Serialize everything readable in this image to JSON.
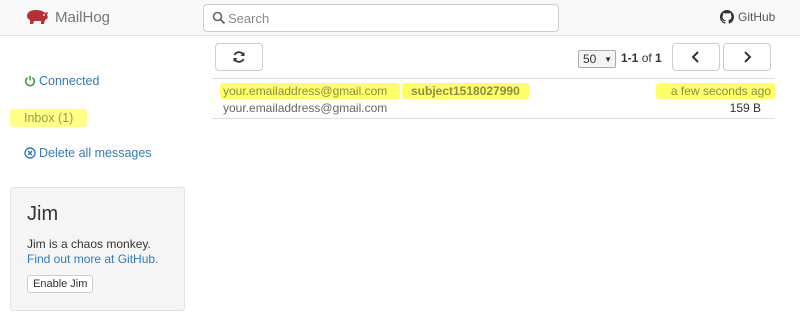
{
  "navbar": {
    "brand": "MailHog",
    "search_placeholder": "Search",
    "github_label": "GitHub"
  },
  "sidebar": {
    "connected_label": "Connected",
    "inbox_label": "Inbox (1)",
    "delete_label": "Delete all messages",
    "jim": {
      "title": "Jim",
      "description": "Jim is a chaos monkey.",
      "link_label": "Find out more at GitHub.",
      "button_label": "Enable Jim"
    }
  },
  "toolbar": {
    "per_page": "50",
    "range": "1-1",
    "of_label": "of",
    "total": "1"
  },
  "messages": [
    {
      "from": "your.emailaddress@gmail.com",
      "to": "your.emailaddress@gmail.com",
      "subject": "subject1518027990",
      "time": "a few seconds ago",
      "size": "159 B"
    }
  ],
  "colors": {
    "highlight": "#ffff66",
    "link": "#337ab7",
    "brand_icon": "#b5313a"
  }
}
